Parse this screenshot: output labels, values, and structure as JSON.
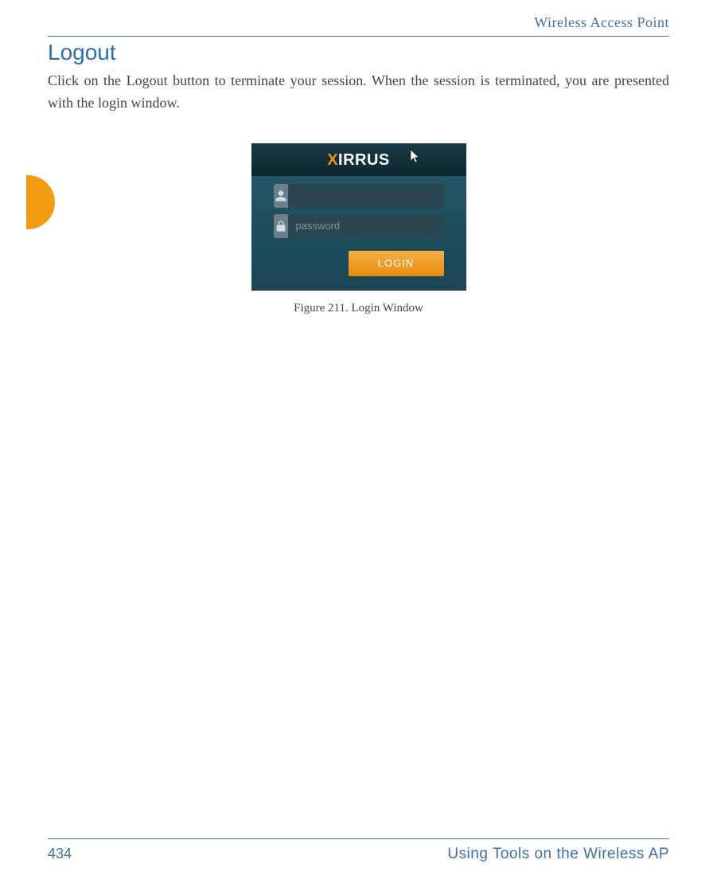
{
  "header": {
    "running_head": "Wireless Access Point"
  },
  "section": {
    "heading": "Logout",
    "body": "Click on the Logout button to terminate your session. When the session is terminated, you are presented with the login window."
  },
  "figure": {
    "brand_pre": "X",
    "brand_rest": "IRRUS",
    "username_value": "",
    "password_placeholder": "password",
    "login_button_label": "LOGIN",
    "caption": "Figure 211. Login Window"
  },
  "footer": {
    "page_number": "434",
    "title": "Using Tools on the Wireless AP"
  },
  "icons": {
    "user": "user-icon",
    "lock": "lock-icon",
    "cursor": "cursor-icon"
  }
}
